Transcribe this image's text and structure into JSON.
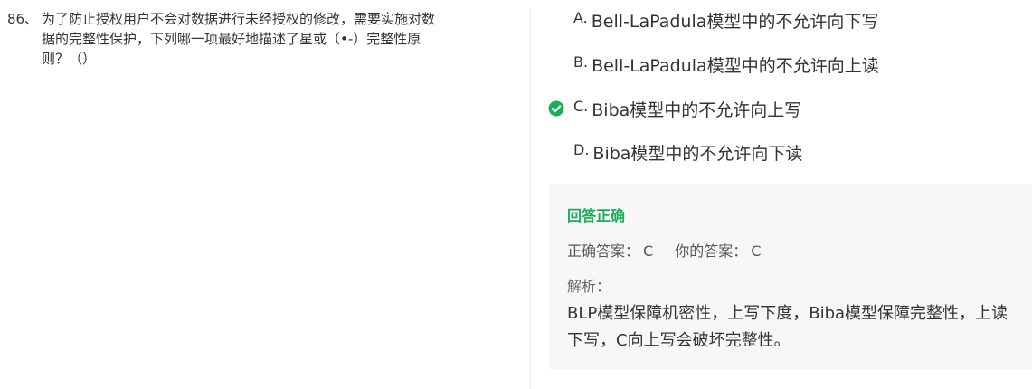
{
  "question": {
    "number": "86、",
    "line1": "为了防止授权用户不会对数据进行未经授权的修改，需要实施对数",
    "line2": "据的完整性保护，下列哪一项最好地描述了星或（•-）完整性原",
    "line3": "则？（）"
  },
  "options": [
    {
      "letter": "A.",
      "text": "Bell-LaPadula模型中的不允许向下写",
      "correct": false
    },
    {
      "letter": "B.",
      "text": "Bell-LaPadula模型中的不允许向上读",
      "correct": false
    },
    {
      "letter": "C.",
      "text": "Biba模型中的不允许向上写",
      "correct": true
    },
    {
      "letter": "D.",
      "text": "Biba模型中的不允许向下读",
      "correct": false
    }
  ],
  "result": {
    "status": "回答正确",
    "correct_answer_label": "正确答案：",
    "correct_answer": "C",
    "your_answer_label": "你的答案：",
    "your_answer": "C",
    "analysis_label": "解析：",
    "analysis_text": "BLP模型保障机密性，上写下度，Biba模型保障完整性，上读下写，C向上写会破坏完整性。"
  },
  "colors": {
    "correct_green": "#1aad5b",
    "panel_bg": "#f7f7f7",
    "text": "#333333"
  },
  "icons": {
    "correct_mark": "check-circle-icon"
  }
}
